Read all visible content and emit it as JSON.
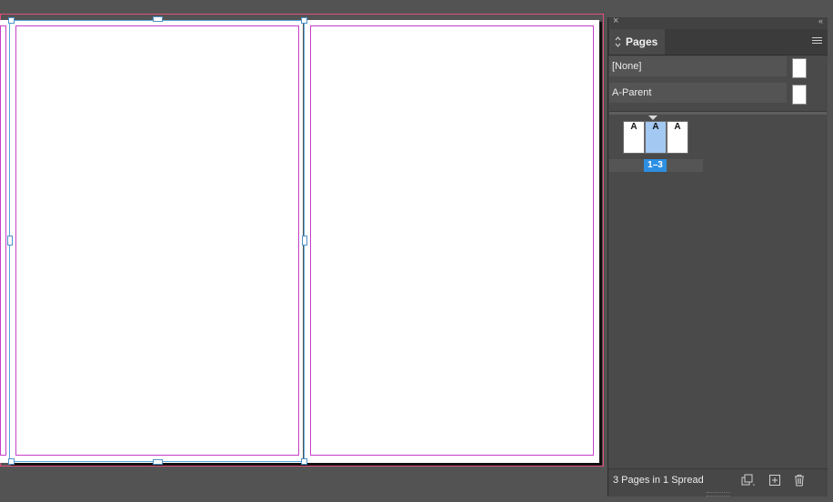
{
  "panel": {
    "close_glyph": "×",
    "collapse_glyph": "‹‹",
    "tab_label": "Pages",
    "tab_sort_glyph": "◇",
    "parents": [
      {
        "label": "[None]"
      },
      {
        "label": "A-Parent"
      }
    ],
    "spread": {
      "pages": [
        {
          "prefix": "A",
          "selected": false
        },
        {
          "prefix": "A",
          "selected": true
        },
        {
          "prefix": "A",
          "selected": false
        }
      ],
      "label": "1–3"
    },
    "footer": {
      "status": "3 Pages in 1 Spread",
      "icons": [
        "edit-page-size-icon",
        "new-page-icon",
        "delete-page-icon"
      ]
    }
  },
  "colors": {
    "margin_guide": "#c53ec7",
    "bleed_guide": "#e0507a",
    "selection": "#5aa6d6",
    "selected_page": "#a3c8f2",
    "spread_label": "#2d8fe2"
  }
}
